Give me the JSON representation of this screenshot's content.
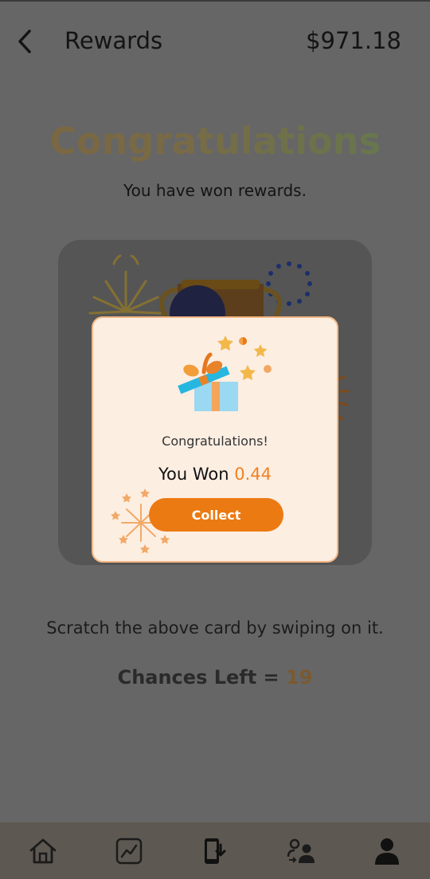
{
  "header": {
    "title": "Rewards",
    "balance": "$971.18",
    "back_icon": "chevron-left-icon"
  },
  "main": {
    "title": "Congratulations",
    "subtitle": "You have won rewards.",
    "instruction": "Scratch the above card by swiping on it.",
    "chances_label": "Chances Left = ",
    "chances_count": "19"
  },
  "modal": {
    "congrats": "Congratulations!",
    "won_label": "You Won ",
    "won_amount": "0.44",
    "collect_label": "Collect"
  },
  "bottom_nav": [
    {
      "icon": "home-icon"
    },
    {
      "icon": "chart-icon"
    },
    {
      "icon": "phone-download-icon"
    },
    {
      "icon": "user-transfer-icon"
    },
    {
      "icon": "profile-icon"
    }
  ],
  "colors": {
    "accent": "#ec7a12",
    "won_amount": "#ee8226",
    "modal_bg": "#fdeee2",
    "overlay": "#666666"
  }
}
